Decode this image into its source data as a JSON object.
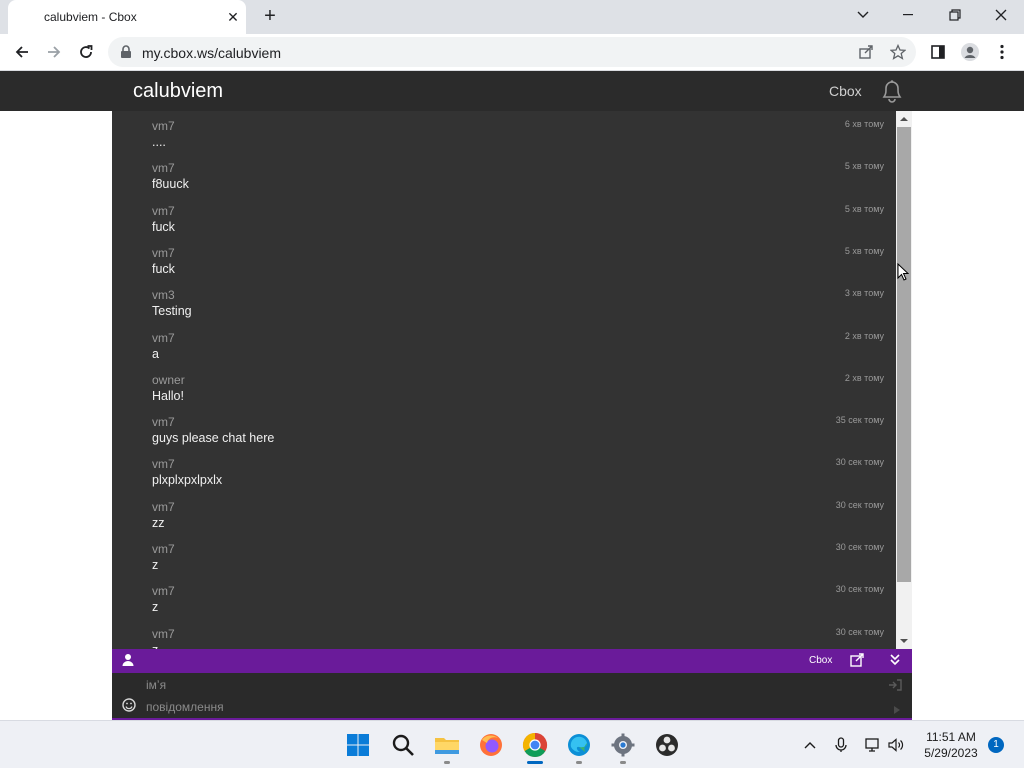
{
  "browser": {
    "tab_title": "calubviem - Cbox",
    "url": "my.cbox.ws/calubviem"
  },
  "site": {
    "title": "calubviem",
    "nav_link": "Cbox"
  },
  "messages": [
    {
      "name": "vm7",
      "time": "6 хв тому",
      "text": "...."
    },
    {
      "name": "vm7",
      "time": "5 хв тому",
      "text": "f8uuck"
    },
    {
      "name": "vm7",
      "time": "5 хв тому",
      "text": "fuck"
    },
    {
      "name": "vm7",
      "time": "5 хв тому",
      "text": "fuck"
    },
    {
      "name": "vm3",
      "time": "3 хв тому",
      "text": "Testing"
    },
    {
      "name": "vm7",
      "time": "2 хв тому",
      "text": "a"
    },
    {
      "name": "owner",
      "time": "2 хв тому",
      "text": "Hallo!"
    },
    {
      "name": "vm7",
      "time": "35 сек тому",
      "text": "guys please chat here"
    },
    {
      "name": "vm7",
      "time": "30 сек тому",
      "text": "plxplxpxlpxlx"
    },
    {
      "name": "vm7",
      "time": "30 сек тому",
      "text": "zz"
    },
    {
      "name": "vm7",
      "time": "30 сек тому",
      "text": "z"
    },
    {
      "name": "vm7",
      "time": "30 сек тому",
      "text": "z"
    },
    {
      "name": "vm7",
      "time": "30 сек тому",
      "text": "z"
    }
  ],
  "chat_bar": {
    "brand": "Cbox"
  },
  "form": {
    "name_placeholder": "імʼя",
    "message_placeholder": "повідомлення"
  },
  "taskbar": {
    "time": "11:51 AM",
    "date": "5/29/2023",
    "notifications": "1"
  },
  "colors": {
    "accent": "#6a1b9a",
    "header_bg": "#2b2b2b",
    "chat_bg": "#333333"
  }
}
